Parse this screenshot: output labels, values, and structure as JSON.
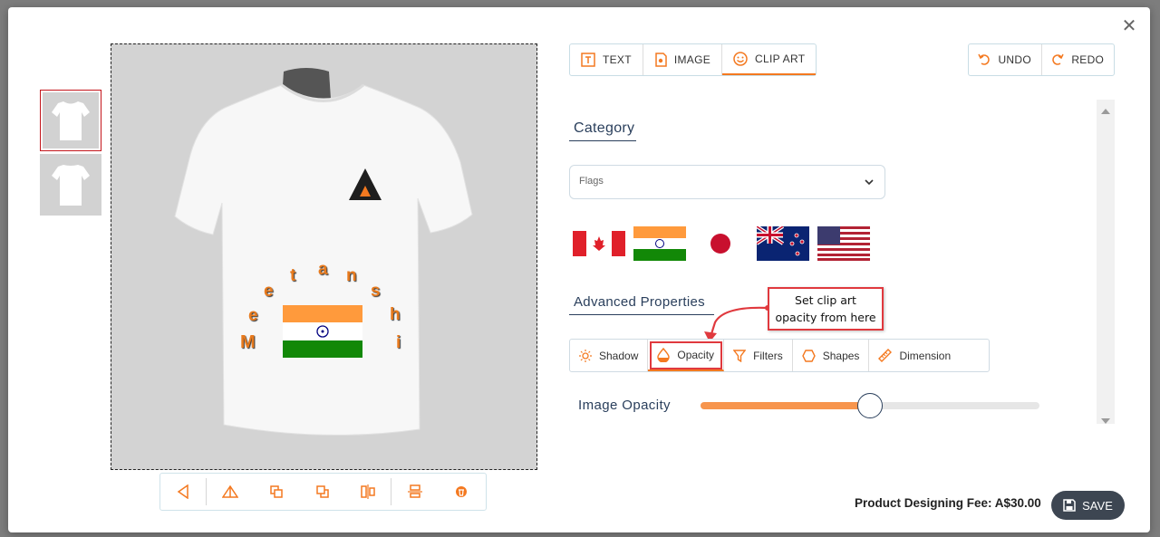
{
  "toolbar_tabs": [
    {
      "label": "TEXT",
      "icon": "text-icon"
    },
    {
      "label": "IMAGE",
      "icon": "image-icon"
    },
    {
      "label": "CLIP ART",
      "icon": "clipart-icon"
    }
  ],
  "history": {
    "undo": "UNDO",
    "redo": "REDO"
  },
  "category": {
    "title": "Category",
    "selected": "Flags"
  },
  "flags": [
    "canada-flag",
    "india-flag",
    "japan-flag",
    "new-zealand-flag",
    "usa-flag"
  ],
  "advanced": {
    "title": "Advanced Properties",
    "tabs": [
      {
        "label": "Shadow",
        "icon": "sun-icon"
      },
      {
        "label": "Opacity",
        "icon": "drop-icon"
      },
      {
        "label": "Filters",
        "icon": "funnel-icon"
      },
      {
        "label": "Shapes",
        "icon": "hexagon-icon"
      },
      {
        "label": "Dimension",
        "icon": "ruler-icon"
      }
    ]
  },
  "callout": {
    "line1": "Set clip art",
    "line2": "opacity from here"
  },
  "opacity": {
    "label": "Image Opacity",
    "value_fraction": 0.5
  },
  "design_text": "Meetanshi",
  "fee": "Product Designing Fee: A$30.00",
  "save_label": "SAVE",
  "colors": {
    "accent": "#f47920",
    "navy": "#2a3f5c",
    "highlight": "#e0393e"
  }
}
